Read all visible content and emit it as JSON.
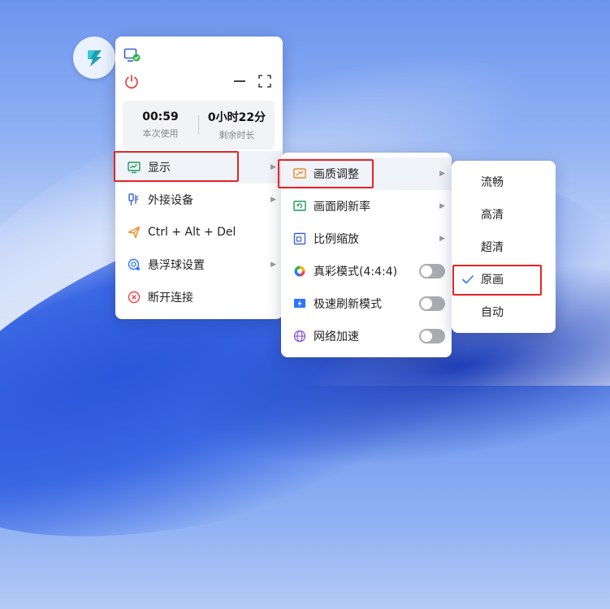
{
  "colors": {
    "accent": "#2b76ff",
    "highlight": "#e62424",
    "danger": "#e54848"
  },
  "panel": {
    "stats": [
      {
        "value": "00:59",
        "label": "本次使用"
      },
      {
        "value": "0小时22分",
        "label": "剩余时长"
      }
    ],
    "menu": [
      {
        "label": "显示",
        "icon": "monitor-icon"
      },
      {
        "label": "外接设备",
        "icon": "usb-icon"
      },
      {
        "label": "Ctrl + Alt + Del",
        "icon": "send-icon"
      },
      {
        "label": "悬浮球设置",
        "icon": "float-ball-icon"
      },
      {
        "label": "断开连接",
        "icon": "disconnect-icon"
      }
    ]
  },
  "display_menu": [
    {
      "label": "画质调整",
      "icon": "image-quality-icon"
    },
    {
      "label": "画面刷新率",
      "icon": "refresh-rate-icon"
    },
    {
      "label": "比例缩放",
      "icon": "scale-icon"
    },
    {
      "label": "真彩模式(4:4:4)",
      "icon": "true-color-icon",
      "toggle": false
    },
    {
      "label": "极速刷新模式",
      "icon": "fast-refresh-icon",
      "toggle": false
    },
    {
      "label": "网络加速",
      "icon": "network-accel-icon",
      "toggle": false
    }
  ],
  "quality_menu": {
    "selected": "原画",
    "options": [
      "流畅",
      "高清",
      "超清",
      "原画",
      "自动"
    ]
  }
}
